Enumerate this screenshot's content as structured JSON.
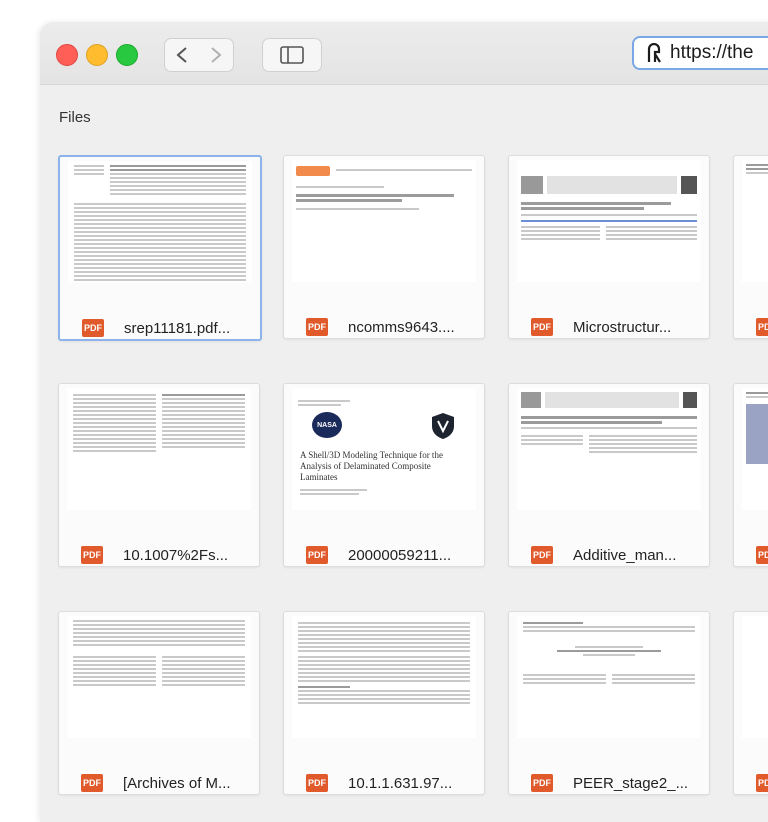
{
  "browser": {
    "url": "https://the"
  },
  "section": {
    "title": "Files"
  },
  "file_type_label": "PDF",
  "thumb_text": {
    "nasa_label": "NASA",
    "shell_title": "A Shell/3D Modeling Technique for the Analysis of Delaminated Composite Laminates"
  },
  "files": [
    {
      "name": "srep11181.pdf..."
    },
    {
      "name": "ncomms9643...."
    },
    {
      "name": "Microstructur..."
    },
    {
      "name": ""
    },
    {
      "name": "10.1007%2Fs..."
    },
    {
      "name": "20000059211..."
    },
    {
      "name": "Additive_man..."
    },
    {
      "name": ""
    },
    {
      "name": "[Archives of M..."
    },
    {
      "name": "10.1.1.631.97..."
    },
    {
      "name": "PEER_stage2_..."
    },
    {
      "name": ""
    }
  ],
  "colors": {
    "pdf_badge": "#e05a2b",
    "selection": "#8eb3ec",
    "close": "#ff5f57",
    "minimize": "#febc2e",
    "zoom": "#28c840"
  }
}
